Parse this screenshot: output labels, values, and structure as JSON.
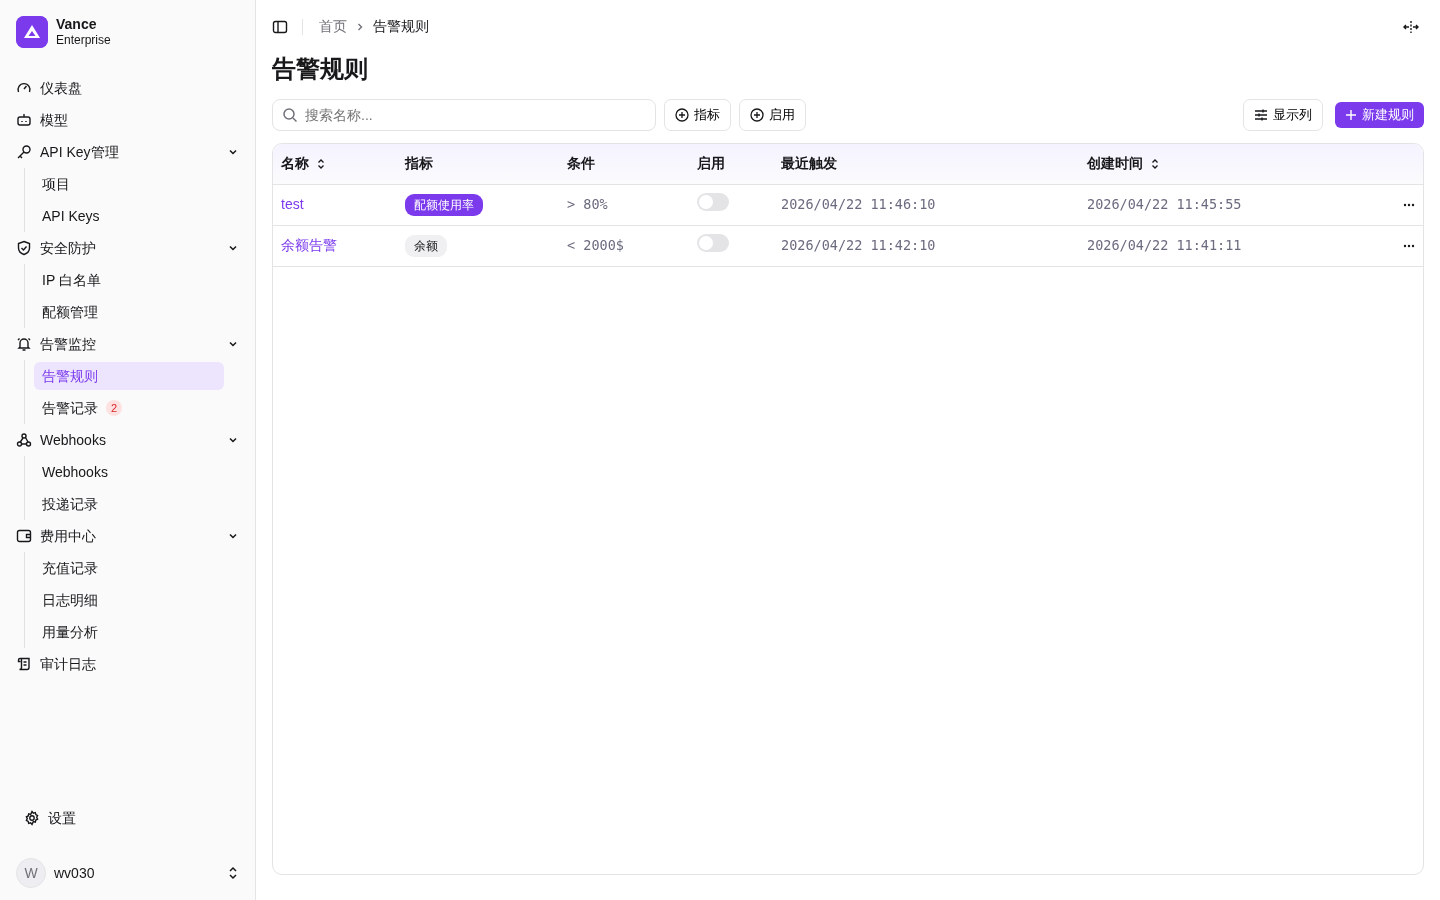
{
  "brand": {
    "name": "Vance",
    "plan": "Enterprise"
  },
  "sidebar": {
    "items": [
      {
        "label": "仪表盘"
      },
      {
        "label": "模型"
      },
      {
        "label": "API Key管理",
        "expanded": true,
        "children": [
          {
            "label": "项目",
            "selected": false
          },
          {
            "label": "API Keys",
            "selected": false
          }
        ]
      },
      {
        "label": "安全防护",
        "expanded": true,
        "children": [
          {
            "label": "IP 白名单",
            "selected": false
          },
          {
            "label": "配额管理",
            "selected": false
          }
        ]
      },
      {
        "label": "告警监控",
        "expanded": true,
        "children": [
          {
            "label": "告警规则",
            "selected": true
          },
          {
            "label": "告警记录",
            "selected": false,
            "badge": "2"
          }
        ]
      },
      {
        "label": "Webhooks",
        "expanded": true,
        "children": [
          {
            "label": "Webhooks",
            "selected": false
          },
          {
            "label": "投递记录",
            "selected": false
          }
        ]
      },
      {
        "label": "费用中心",
        "expanded": true,
        "children": [
          {
            "label": "充值记录",
            "selected": false
          },
          {
            "label": "日志明细",
            "selected": false
          },
          {
            "label": "用量分析",
            "selected": false
          }
        ]
      },
      {
        "label": "审计日志"
      }
    ],
    "settings": "设置",
    "user": {
      "initial": "W",
      "name": "wv030"
    }
  },
  "breadcrumb": [
    "首页",
    "告警规则"
  ],
  "page_title": "告警规则",
  "toolbar": {
    "search": {
      "placeholder": "搜索名称..."
    },
    "filters": [
      "指标",
      "启用"
    ],
    "columns_button": "显示列",
    "new_button": "新建规则"
  },
  "table": {
    "columns": [
      {
        "label": "名称",
        "sortable": true
      },
      {
        "label": "指标",
        "sortable": false
      },
      {
        "label": "条件",
        "sortable": false
      },
      {
        "label": "启用",
        "sortable": false
      },
      {
        "label": "最近触发",
        "sortable": false
      },
      {
        "label": "创建时间",
        "sortable": true
      }
    ],
    "rows": [
      {
        "name": "test",
        "metric": {
          "label": "配额使用率",
          "kind": "primary"
        },
        "condition": "> 80%",
        "enabled": false,
        "last_triggered": "2026/04/22 11:46:10",
        "created": "2026/04/22 11:45:55"
      },
      {
        "name": "余额告警",
        "metric": {
          "label": "余额",
          "kind": "neutral"
        },
        "condition": "< 2000$",
        "enabled": false,
        "last_triggered": "2026/04/22 11:42:10",
        "created": "2026/04/22 11:41:11"
      }
    ]
  }
}
